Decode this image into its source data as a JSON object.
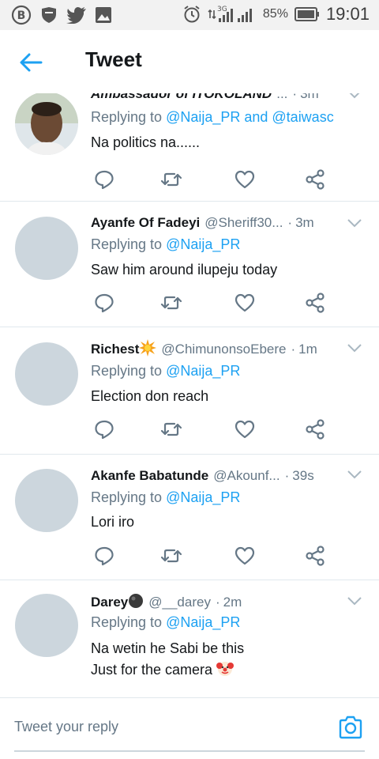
{
  "status_bar": {
    "battery_percent": "85%",
    "clock": "19:01",
    "network": "3G",
    "left_icons": [
      "b-badge-icon",
      "shield-icon",
      "twitter-bird-icon",
      "image-icon"
    ],
    "right_icons": [
      "alarm-icon",
      "signal-icon",
      "battery-icon"
    ]
  },
  "header": {
    "title": "Tweet",
    "back_icon": "arrow-left-icon",
    "accent_color": "#1da1f2"
  },
  "tweets": [
    {
      "name": "Ambassador of ITOKOLAND",
      "handle": "...",
      "time": "3m",
      "replying_prefix": "Replying to ",
      "mentions": "@Naija_PR and @taiwasc",
      "text": "Na politics na......",
      "has_photo_avatar": true
    },
    {
      "name": "Ayanfe Of Fadeyi",
      "handle": "@Sheriff30...",
      "time": "3m",
      "replying_prefix": "Replying to ",
      "mentions": "@Naija_PR",
      "text": "Saw him around ilupeju today"
    },
    {
      "name": "Richest",
      "name_emoji": "collision-emoji",
      "handle": "@ChimunonsoEbere",
      "time": "1m",
      "replying_prefix": "Replying to ",
      "mentions": "@Naija_PR",
      "text": "Election don reach"
    },
    {
      "name": "Akanfe Babatunde",
      "handle": "@Akounf...",
      "time": "39s",
      "replying_prefix": "Replying to ",
      "mentions": "@Naija_PR",
      "text": "Lori iro"
    },
    {
      "name": "Darey",
      "name_emoji": "black-circle-emoji",
      "handle": "@__darey",
      "time": "2m",
      "replying_prefix": "Replying to ",
      "mentions": "@Naija_PR",
      "text_line1": "Na wetin he Sabi be this",
      "text_line2": "Just for the camera",
      "text_emoji": "clown-face-emoji"
    }
  ],
  "compose": {
    "placeholder": "Tweet your reply",
    "camera_icon": "camera-icon"
  }
}
